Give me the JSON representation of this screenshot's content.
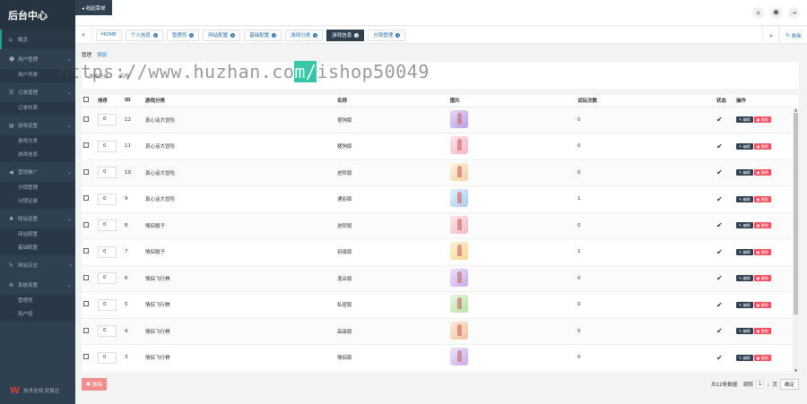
{
  "app": {
    "title": "后台中心",
    "collapse_label": "◂ 收起菜单"
  },
  "sidebar": {
    "items": [
      {
        "icon": "home-icon",
        "glyph": "⌂",
        "label": "概览",
        "has_children": false
      },
      {
        "icon": "users-icon",
        "glyph": "☻",
        "label": "用户管理",
        "has_children": true,
        "children": [
          "用户列表"
        ]
      },
      {
        "icon": "order-icon",
        "glyph": "☰",
        "label": "订单管理",
        "has_children": true,
        "children": [
          "订单列表"
        ]
      },
      {
        "icon": "game-icon",
        "glyph": "▤",
        "label": "游戏设置",
        "has_children": true,
        "children": [
          "游戏分类",
          "游戏信息"
        ]
      },
      {
        "icon": "megaphone-icon",
        "glyph": "◀",
        "label": "营销推广",
        "has_children": true,
        "children": [
          "分销管理",
          "分销记录"
        ]
      },
      {
        "icon": "sitemap-icon",
        "glyph": "♣",
        "label": "网站设置",
        "has_children": true,
        "children": [
          "网站配置",
          "基础配置"
        ]
      },
      {
        "icon": "edit-icon",
        "glyph": "✎",
        "label": "网站日志",
        "has_children": true,
        "children": []
      },
      {
        "icon": "gear-icon",
        "glyph": "⚙",
        "label": "系统设置",
        "has_children": true,
        "children": [
          "管理员",
          "用户组"
        ]
      }
    ],
    "footer": "技术支持 武易达"
  },
  "tabs": {
    "items": [
      {
        "label": "HOME",
        "closable": false,
        "active": false
      },
      {
        "label": "个人信息",
        "closable": true,
        "active": false
      },
      {
        "label": "管理员",
        "closable": true,
        "active": false
      },
      {
        "label": "网站配置",
        "closable": true,
        "active": false
      },
      {
        "label": "基础配置",
        "closable": true,
        "active": false
      },
      {
        "label": "游戏分类",
        "closable": true,
        "active": false
      },
      {
        "label": "游戏信息",
        "closable": true,
        "active": true
      },
      {
        "label": "分销管理",
        "closable": true,
        "active": false
      }
    ],
    "refresh_label": "刷新"
  },
  "subtabs": {
    "manage": "管理",
    "add": "添加"
  },
  "search": {
    "category_label": "游戏分类",
    "name_label": "名称"
  },
  "table": {
    "headers": [
      "",
      "排序",
      "ID",
      "游戏分类",
      "名称",
      "图片",
      "试玩次数",
      "状态",
      "操作"
    ],
    "edit_label": "编辑",
    "delete_label": "删除",
    "rows": [
      {
        "sort": "0",
        "id": "12",
        "category": "真心话大冒险",
        "name": "很狗版",
        "plays": "0",
        "thumb": [
          "#e8d4f0",
          "#b7a3e8"
        ]
      },
      {
        "sort": "0",
        "id": "11",
        "category": "真心话大冒险",
        "name": "猪狗版",
        "plays": "0",
        "thumb": [
          "#fce4ec",
          "#f4b6c2"
        ]
      },
      {
        "sort": "0",
        "id": "10",
        "category": "真心话大冒险",
        "name": "进阶版",
        "plays": "0",
        "thumb": [
          "#fff3e0",
          "#f5cfa3"
        ]
      },
      {
        "sort": "0",
        "id": "9",
        "category": "真心话大冒险",
        "name": "通俗版",
        "plays": "1",
        "thumb": [
          "#e3f2fd",
          "#a9c9f0"
        ]
      },
      {
        "sort": "0",
        "id": "8",
        "category": "情侣骰子",
        "name": "进阶版",
        "plays": "0",
        "thumb": [
          "#fde7ea",
          "#f4b7c0"
        ]
      },
      {
        "sort": "0",
        "id": "7",
        "category": "情侣骰子",
        "name": "初级版",
        "plays": "1",
        "thumb": [
          "#fff4d6",
          "#f4d58f"
        ]
      },
      {
        "sort": "0",
        "id": "6",
        "category": "情侣飞行棋",
        "name": "混合版",
        "plays": "0",
        "thumb": [
          "#ede2f7",
          "#c9a6ec"
        ]
      },
      {
        "sort": "0",
        "id": "5",
        "category": "情侣飞行棋",
        "name": "私密版",
        "plays": "0",
        "thumb": [
          "#e8f5e0",
          "#b9e0a2"
        ]
      },
      {
        "sort": "0",
        "id": "4",
        "category": "情侣飞行棋",
        "name": "高级版",
        "plays": "0",
        "thumb": [
          "#fdeadb",
          "#f4c29b"
        ]
      },
      {
        "sort": "0",
        "id": "3",
        "category": "情侣飞行棋",
        "name": "情侣版",
        "plays": "0",
        "thumb": [
          "#efe4f8",
          "#c8aaee"
        ]
      }
    ]
  },
  "footer": {
    "delete_label": "删除",
    "total": "共12条数据",
    "jump_label": "跳转",
    "page": "1",
    "page_unit": "页",
    "confirm_label": "确定"
  },
  "watermark": {
    "prefix": "https://www.huzhan.co",
    "highlight": "m/",
    "suffix": "ishop50049"
  }
}
